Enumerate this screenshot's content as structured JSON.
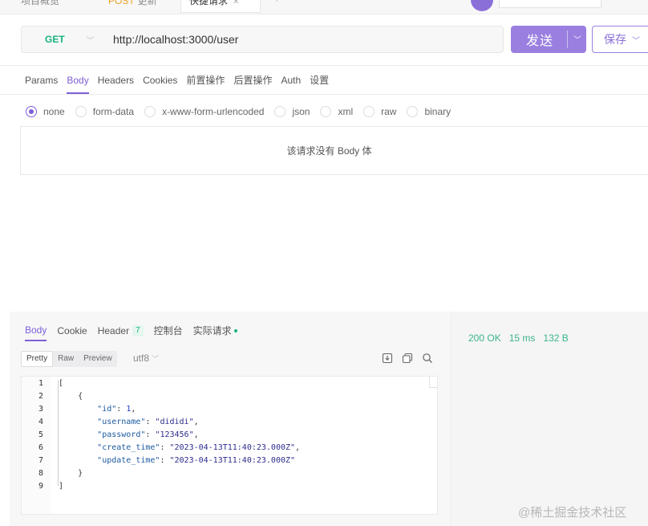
{
  "tabs": {
    "tab1": "项目概览",
    "tab2_method": "POST",
    "tab2": "更新",
    "tab3": "快捷请求",
    "plus": "+"
  },
  "request": {
    "method": "GET",
    "url": "http://localhost:3000/user",
    "send_label": "发送",
    "save_label": "保存"
  },
  "request_tabs": [
    "Params",
    "Body",
    "Headers",
    "Cookies",
    "前置操作",
    "后置操作",
    "Auth",
    "设置"
  ],
  "body_types": [
    {
      "label": "none",
      "selected": true
    },
    {
      "label": "form-data",
      "selected": false
    },
    {
      "label": "x-www-form-urlencoded",
      "selected": false
    },
    {
      "label": "json",
      "selected": false
    },
    {
      "label": "xml",
      "selected": false
    },
    {
      "label": "raw",
      "selected": false
    },
    {
      "label": "binary",
      "selected": false
    }
  ],
  "no_body_text": "该请求没有 Body 体",
  "response": {
    "tabs": {
      "body": "Body",
      "cookie": "Cookie",
      "header": "Header",
      "header_count": "7",
      "console": "控制台",
      "actual": "实际请求"
    },
    "status": "200 OK",
    "time": "15 ms",
    "size": "132 B",
    "view_modes": [
      "Pretty",
      "Raw",
      "Preview"
    ],
    "encoding": "utf8",
    "code_lines": [
      {
        "n": "1",
        "parts": [
          {
            "t": "[",
            "c": ""
          }
        ]
      },
      {
        "n": "2",
        "parts": [
          {
            "t": "    {",
            "c": ""
          }
        ]
      },
      {
        "n": "3",
        "parts": [
          {
            "t": "        ",
            "c": ""
          },
          {
            "t": "\"id\"",
            "c": "key"
          },
          {
            "t": ": ",
            "c": ""
          },
          {
            "t": "1",
            "c": "num"
          },
          {
            "t": ",",
            "c": ""
          }
        ]
      },
      {
        "n": "4",
        "parts": [
          {
            "t": "        ",
            "c": ""
          },
          {
            "t": "\"username\"",
            "c": "key"
          },
          {
            "t": ": ",
            "c": ""
          },
          {
            "t": "\"dididi\"",
            "c": "str"
          },
          {
            "t": ",",
            "c": ""
          }
        ]
      },
      {
        "n": "5",
        "parts": [
          {
            "t": "        ",
            "c": ""
          },
          {
            "t": "\"password\"",
            "c": "key"
          },
          {
            "t": ": ",
            "c": ""
          },
          {
            "t": "\"123456\"",
            "c": "str"
          },
          {
            "t": ",",
            "c": ""
          }
        ]
      },
      {
        "n": "6",
        "parts": [
          {
            "t": "        ",
            "c": ""
          },
          {
            "t": "\"create_time\"",
            "c": "key"
          },
          {
            "t": ": ",
            "c": ""
          },
          {
            "t": "\"2023-04-13T11:40:23.000Z\"",
            "c": "str"
          },
          {
            "t": ",",
            "c": ""
          }
        ]
      },
      {
        "n": "7",
        "parts": [
          {
            "t": "        ",
            "c": ""
          },
          {
            "t": "\"update_time\"",
            "c": "key"
          },
          {
            "t": ": ",
            "c": ""
          },
          {
            "t": "\"2023-04-13T11:40:23.000Z\"",
            "c": "str"
          }
        ]
      },
      {
        "n": "8",
        "parts": [
          {
            "t": "    }",
            "c": ""
          }
        ]
      },
      {
        "n": "9",
        "parts": [
          {
            "t": "]",
            "c": ""
          }
        ]
      }
    ]
  },
  "icons": {
    "download": "download-icon",
    "copy": "copy-icon",
    "search": "search-icon"
  },
  "colors": {
    "accent": "#7e5fd6",
    "send_bg": "#9a7fe0",
    "method_get": "#19b37a",
    "status_ok": "#3ab48a"
  },
  "watermark": "@稀土掘金技术社区"
}
